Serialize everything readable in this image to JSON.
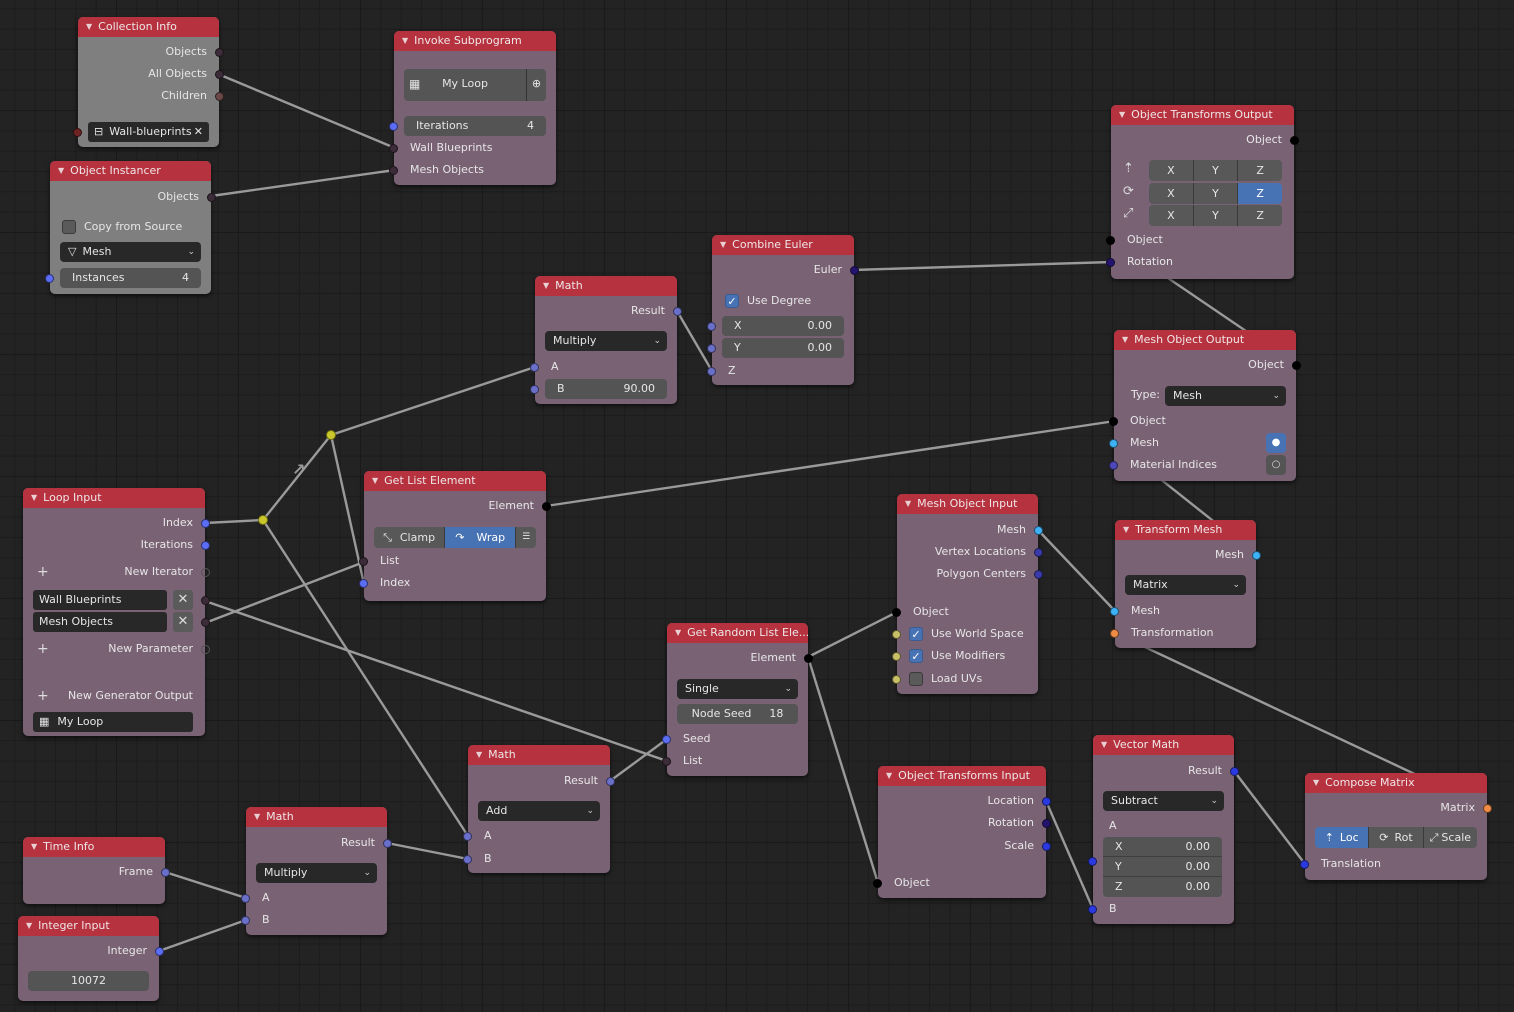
{
  "editor": {
    "type": "node-editor",
    "accent_color": "#b5323e",
    "selected_color": "#4772b3"
  },
  "nodes": {
    "collection_info": {
      "title": "Collection Info",
      "outputs": [
        "Objects",
        "All Objects",
        "Children"
      ],
      "collection_name": "Wall-blueprints",
      "collection_icon": "collection-box-icon",
      "clear_icon": "✕"
    },
    "object_instancer": {
      "title": "Object Instancer",
      "outputs": [
        "Objects"
      ],
      "copy_from_source_label": "Copy from Source",
      "copy_from_source_checked": false,
      "type_value": "Mesh",
      "instances_label": "Instances",
      "instances_value": "4"
    },
    "invoke_subprogram": {
      "title": "Invoke Subprogram",
      "subprogram": "My Loop",
      "iterations_label": "Iterations",
      "iterations_value": "4",
      "inputs": [
        "Wall Blueprints",
        "Mesh Objects"
      ]
    },
    "object_transforms_output": {
      "title": "Object Transforms Output",
      "outputs": [
        "Object"
      ],
      "axes": [
        "X",
        "Y",
        "Z"
      ],
      "rows": [
        {
          "icon": "location-icon",
          "selected": []
        },
        {
          "icon": "rotation-icon",
          "selected": [
            "Z"
          ]
        },
        {
          "icon": "scale-icon",
          "selected": []
        }
      ],
      "inputs": [
        "Object",
        "Rotation"
      ]
    },
    "math_multiply_top": {
      "title": "Math",
      "outputs": [
        "Result"
      ],
      "operation": "Multiply",
      "a_label": "A",
      "b_label": "B",
      "b_value": "90.00"
    },
    "combine_euler": {
      "title": "Combine Euler",
      "outputs": [
        "Euler"
      ],
      "use_degree_label": "Use Degree",
      "use_degree_checked": true,
      "x_label": "X",
      "x_value": "0.00",
      "y_label": "Y",
      "y_value": "0.00",
      "z_label": "Z"
    },
    "mesh_object_output": {
      "title": "Mesh Object Output",
      "outputs": [
        "Object"
      ],
      "type_label": "Type:",
      "type_value": "Mesh",
      "inputs": [
        "Object",
        "Mesh",
        "Material Indices"
      ],
      "mesh_toggle_on": true,
      "material_toggle_on": false
    },
    "loop_input": {
      "title": "Loop Input",
      "outputs": [
        "Index",
        "Iterations"
      ],
      "new_iterator_label": "New Iterator",
      "parameters": [
        "Wall Blueprints",
        "Mesh Objects"
      ],
      "new_parameter_label": "New Parameter",
      "new_generator_output_label": "New Generator Output",
      "loop_name": "My Loop"
    },
    "get_list_element": {
      "title": "Get List Element",
      "outputs": [
        "Element"
      ],
      "modes": [
        "Clamp",
        "Wrap"
      ],
      "active_mode": "Wrap",
      "inputs": [
        "List",
        "Index"
      ]
    },
    "mesh_object_input": {
      "title": "Mesh Object Input",
      "outputs": [
        "Mesh",
        "Vertex Locations",
        "Polygon Centers"
      ],
      "object_label": "Object",
      "options": [
        {
          "label": "Use World Space",
          "checked": true
        },
        {
          "label": "Use Modifiers",
          "checked": true
        },
        {
          "label": "Load UVs",
          "checked": false
        }
      ]
    },
    "transform_mesh": {
      "title": "Transform Mesh",
      "outputs": [
        "Mesh"
      ],
      "mode": "Matrix",
      "inputs": [
        "Mesh",
        "Transformation"
      ]
    },
    "get_random_list_element": {
      "title": "Get Random List Ele...",
      "outputs": [
        "Element"
      ],
      "mode": "Single",
      "node_seed_label": "Node Seed",
      "node_seed_value": "18",
      "inputs": [
        "Seed",
        "List"
      ]
    },
    "math_add": {
      "title": "Math",
      "outputs": [
        "Result"
      ],
      "operation": "Add",
      "inputs": [
        "A",
        "B"
      ]
    },
    "object_transforms_input": {
      "title": "Object Transforms Input",
      "outputs": [
        "Location",
        "Rotation",
        "Scale"
      ],
      "inputs": [
        "Object"
      ]
    },
    "vector_math": {
      "title": "Vector Math",
      "outputs": [
        "Result"
      ],
      "operation": "Subtract",
      "a_label": "A",
      "a_values": [
        {
          "axis": "X",
          "value": "0.00"
        },
        {
          "axis": "Y",
          "value": "0.00"
        },
        {
          "axis": "Z",
          "value": "0.00"
        }
      ],
      "b_label": "B"
    },
    "compose_matrix": {
      "title": "Compose Matrix",
      "outputs": [
        "Matrix"
      ],
      "modes": [
        "Loc",
        "Rot",
        "Scale"
      ],
      "active_mode": "Loc",
      "inputs": [
        "Translation"
      ]
    },
    "time_info": {
      "title": "Time Info",
      "outputs": [
        "Frame"
      ]
    },
    "math_multiply_bottom": {
      "title": "Math",
      "outputs": [
        "Result"
      ],
      "operation": "Multiply",
      "inputs": [
        "A",
        "B"
      ]
    },
    "integer_input": {
      "title": "Integer Input",
      "outputs": [
        "Integer"
      ],
      "value": "10072"
    }
  }
}
